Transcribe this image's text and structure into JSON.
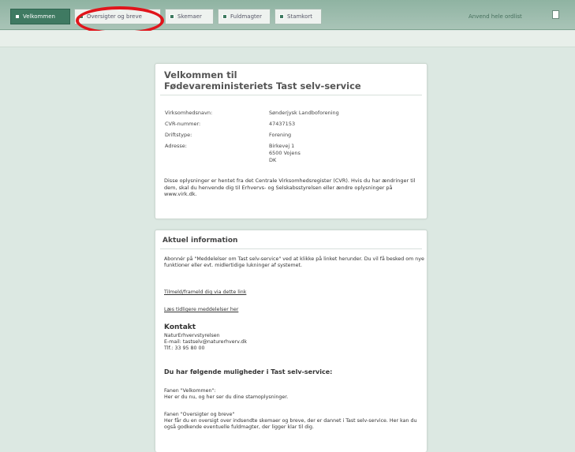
{
  "nav": {
    "tabs": [
      {
        "label": "Velkommen",
        "active": true
      },
      {
        "label": "Oversigter og breve",
        "active": false
      },
      {
        "label": "Skemaer",
        "active": false
      },
      {
        "label": "Fuldmagter",
        "active": false
      },
      {
        "label": "Stamkort",
        "active": false
      }
    ],
    "logout_label": "Anvend hele ordlist"
  },
  "welcome": {
    "title_line1": "Velkommen til",
    "title_line2": "Fødevareministeriets Tast selv-service",
    "rows": [
      {
        "label": "Virksomhedsnavn:",
        "value": "Sønderjysk Landboforening"
      },
      {
        "label": "CVR-nummer:",
        "value": "47437153"
      },
      {
        "label": "Driftstype:",
        "value": "Forening"
      },
      {
        "label": "Adresse:",
        "value": "Birkevej 1",
        "value2": "6500 Vojens",
        "value3": "DK"
      }
    ],
    "description": "Disse oplysninger er hentet fra det Centrale Virksomhedsregister (CVR). Hvis du har ændringer til dem, skal du henvende dig til Erhvervs- og Selskabsstyrelsen eller ændre oplysninger på www.virk.dk."
  },
  "news": {
    "title": "Aktuel information",
    "intro": "Abonnér på \"Meddelelser om Tast selv-service\" ved at klikke på linket herunder. Du vil få besked om nye funktioner eller evt. midlertidige lukninger af systemet.",
    "subscribe_link": "Tilmeld/frameld dig via dette link",
    "old_messages_link": "Læs tidligere meddelelser her",
    "contact": {
      "title": "Kontakt",
      "org": "NaturErhvervstyrelsen",
      "email": "E-mail: tastselv@naturerhverv.dk",
      "phone": "Tlf.: 33 95 80 00"
    },
    "options_title": "Du har følgende muligheder i Tast selv-service:",
    "tab1_name": "Fanen \"Velkommen\":",
    "tab1_desc": "Her er du nu, og her ser du dine stamoplysninger.",
    "tab2_name": "Fanen \"Oversigter og breve\"",
    "tab2_desc": "Her får du en oversigt over indsendte skemaer og breve, der er dannet i Tast selv-service. Her kan du også godkende eventuelle fuldmagter, der ligger klar til dig."
  }
}
